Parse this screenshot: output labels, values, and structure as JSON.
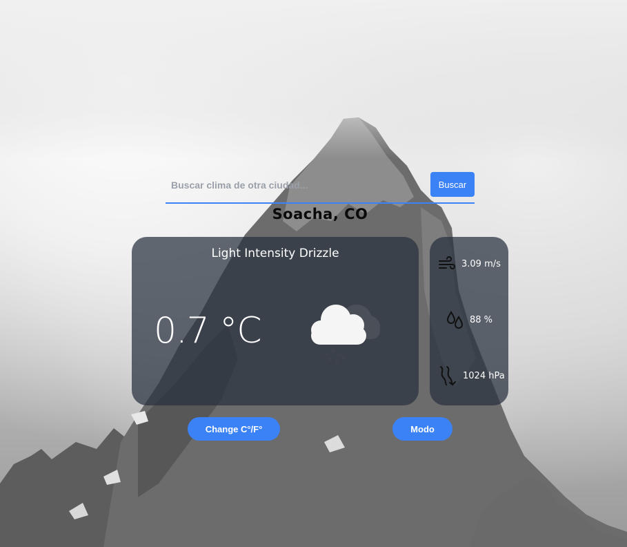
{
  "search": {
    "placeholder": "Buscar clima de otra ciudad...",
    "button_label": "Buscar"
  },
  "location": {
    "city": "Soacha, CO"
  },
  "weather": {
    "description": "Light Intensity Drizzle",
    "temperature": "0.7 °C",
    "icon": "drizzle-cloud-icon"
  },
  "stats": {
    "wind": {
      "icon": "wind-icon",
      "value": "3.09 m/s"
    },
    "humidity": {
      "icon": "humidity-drops-icon",
      "value": "88 %"
    },
    "pressure": {
      "icon": "pressure-icon",
      "value": "1024 hPa"
    }
  },
  "controls": {
    "unit_toggle_label": "Change C°/F°",
    "mode_label": "Modo"
  },
  "colors": {
    "accent": "#3b82f6",
    "card": "#28303e"
  }
}
